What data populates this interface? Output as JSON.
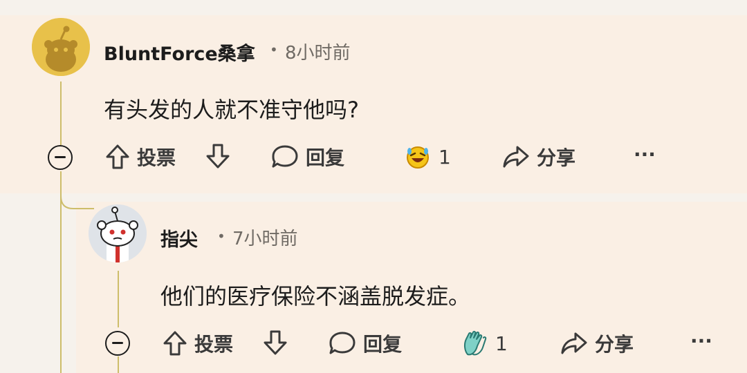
{
  "comments": [
    {
      "username": "BluntForce桑拿",
      "time": "8小时前",
      "text": "有头发的人就不准守他吗?",
      "vote_label": "投票",
      "reply_label": "回复",
      "award_count": "1",
      "share_label": "分享",
      "more_label": "···",
      "avatar_color": "#e8c14a",
      "award_icon": "laughing-face-award-icon"
    },
    {
      "username": "指尖",
      "time": "7小时前",
      "text": "他们的医疗保险不涵盖脱发症。",
      "vote_label": "投票",
      "reply_label": "回复",
      "award_count": "1",
      "share_label": "分享",
      "more_label": "···",
      "avatar_color": "#dfe3e8",
      "award_icon": "clapping-hands-award-icon"
    }
  ],
  "colors": {
    "background": "#f6f2ec",
    "comment_band": "#faefe4",
    "thread_line": "#cdbd6a",
    "text": "#1c1c1c",
    "meta": "#6f6a64"
  }
}
